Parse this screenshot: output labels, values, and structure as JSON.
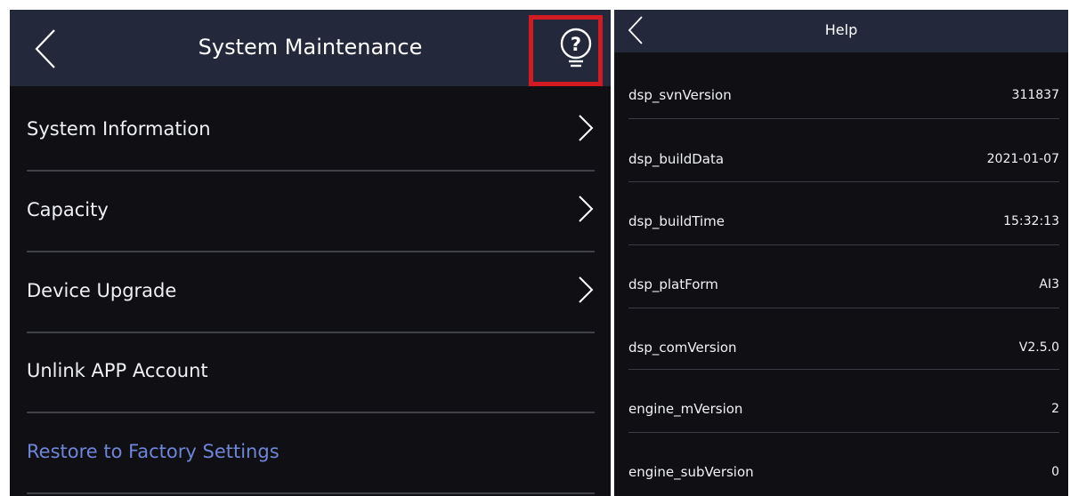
{
  "left_screen": {
    "header": {
      "title": "System Maintenance",
      "back_icon": "chevron-left-icon",
      "help_icon": "help-lightbulb-icon",
      "highlight_color": "#d11a22"
    },
    "menu": [
      {
        "label": "System Information",
        "icon": "chevron-right-icon"
      },
      {
        "label": "Capacity",
        "icon": "chevron-right-icon"
      },
      {
        "label": "Device Upgrade",
        "icon": "chevron-right-icon"
      },
      {
        "label": "Unlink APP Account"
      },
      {
        "label": "Restore to Factory Settings",
        "color": "#6f86d8"
      }
    ]
  },
  "right_screen": {
    "header": {
      "title": "Help",
      "back_icon": "chevron-left-icon"
    },
    "rows": [
      {
        "key": "dsp_svnVersion",
        "value": "311837"
      },
      {
        "key": "dsp_buildData",
        "value": "2021-01-07"
      },
      {
        "key": "dsp_buildTime",
        "value": "15:32:13"
      },
      {
        "key": "dsp_platForm",
        "value": "AI3"
      },
      {
        "key": "dsp_comVersion",
        "value": "V2.5.0"
      },
      {
        "key": "engine_mVersion",
        "value": "2"
      },
      {
        "key": "engine_subVersion",
        "value": "0"
      }
    ]
  },
  "colors": {
    "header_bg": "#23293a",
    "screen_bg": "#0f0f14",
    "link_blue": "#6f86d8"
  }
}
